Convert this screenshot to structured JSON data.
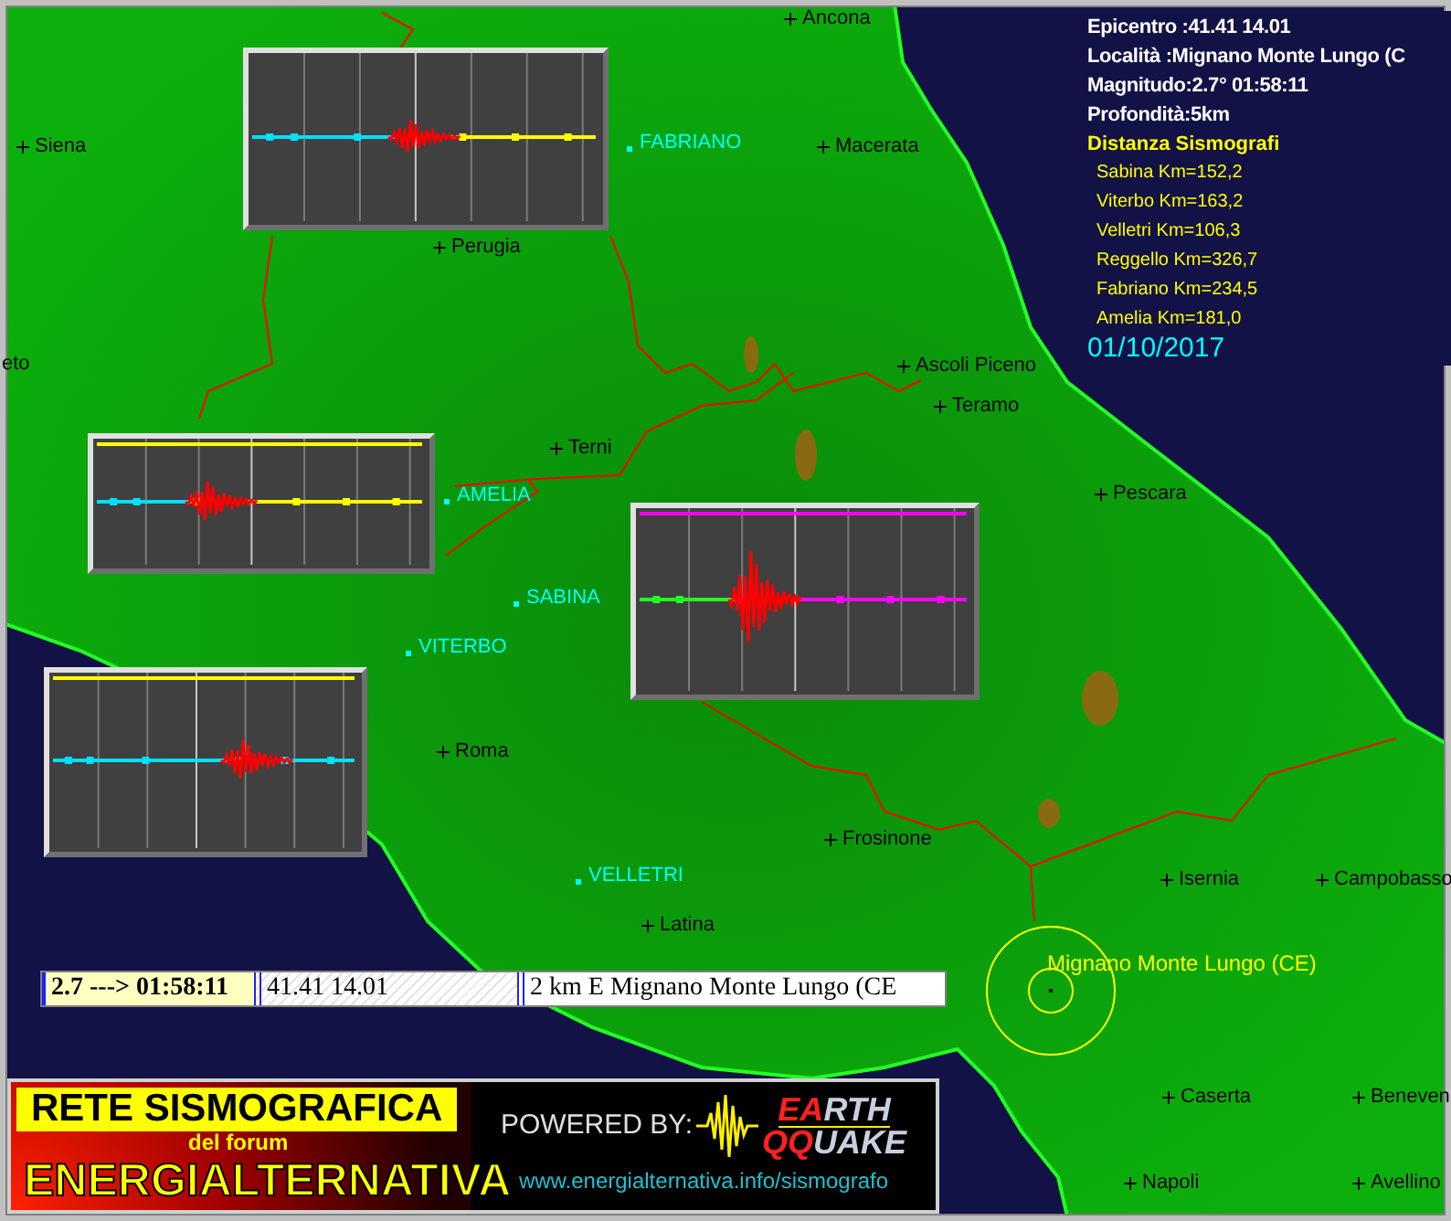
{
  "info_panel": {
    "lines": [
      "Epicentro :41.41 14.01",
      "Località :Mignano Monte Lungo (C",
      "Magnitudo:2.7°  01:58:11",
      "Profondità:5km"
    ],
    "distance_title": "Distanza Sismografi",
    "distances": [
      "Sabina Km=152,2",
      "Viterbo Km=163,2",
      "Velletri Km=106,3",
      "Reggello Km=326,7",
      "Fabriano Km=234,5",
      "Amelia Km=181,0"
    ],
    "date": "01/10/2017"
  },
  "cities": [
    {
      "name": "Ancona"
    },
    {
      "name": "Siena"
    },
    {
      "name": "Macerata"
    },
    {
      "name": "Perugia"
    },
    {
      "name": "eto"
    },
    {
      "name": "Ascoli Piceno"
    },
    {
      "name": "Teramo"
    },
    {
      "name": "Terni"
    },
    {
      "name": "Pescara"
    },
    {
      "name": "Roma"
    },
    {
      "name": "Frosinone"
    },
    {
      "name": "Latina"
    },
    {
      "name": "Isernia"
    },
    {
      "name": "Campobasso"
    },
    {
      "name": "Caserta"
    },
    {
      "name": "Beneven"
    },
    {
      "name": "Napoli"
    },
    {
      "name": "Avellino"
    }
  ],
  "stations": [
    {
      "name": "FABRIANO"
    },
    {
      "name": "AMELIA"
    },
    {
      "name": "SABINA"
    },
    {
      "name": "VITERBO"
    },
    {
      "name": "VELLETRI"
    }
  ],
  "epicenter": {
    "label": "Mignano Monte Lungo (CE)"
  },
  "status_bar": {
    "event": "2.7 ---> 01:58:11",
    "coordinates": "41.41 14.01",
    "location": "2 km E Mignano Monte Lungo (CE"
  },
  "banner": {
    "title": "RETE SISMOGRAFICA",
    "subtitle": "del forum",
    "name": "ENERGIALTERNATIVA",
    "powered_by": "POWERED BY:",
    "logo": {
      "earth_accent": "EA",
      "earth_rest": "RTH",
      "quake_accent": "QQ",
      "quake_rest": "UAKE"
    },
    "url": "www.energialternativa.info/sismografo"
  }
}
